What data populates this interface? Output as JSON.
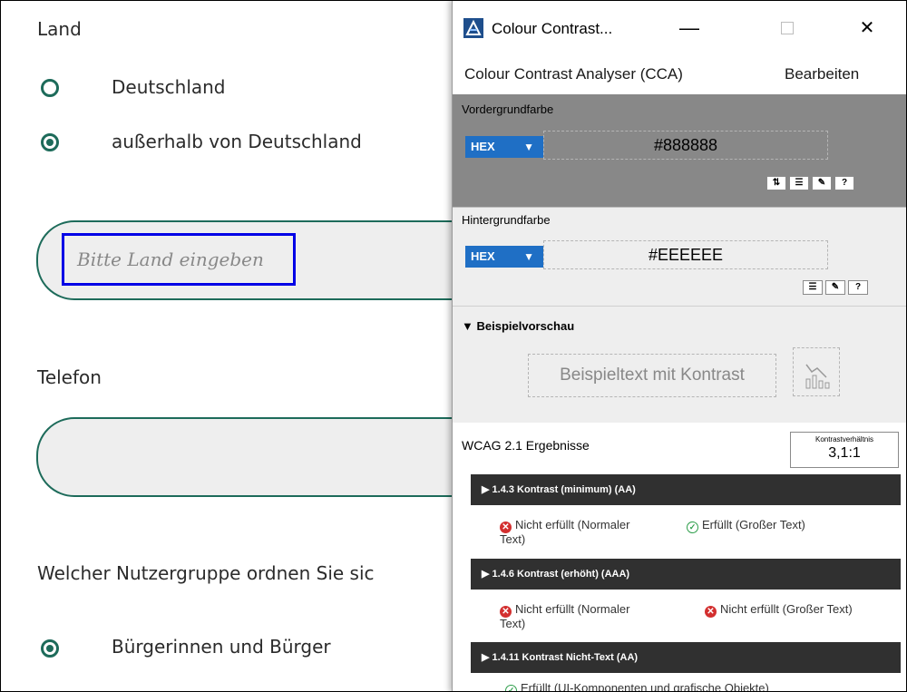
{
  "form": {
    "land_label": "Land",
    "options": [
      "Deutschland",
      "außerhalb von Deutschland"
    ],
    "country_placeholder": "Bitte Land eingeben",
    "telefon_label": "Telefon",
    "group_question": "Welcher Nutzergruppe ordnen Sie sic",
    "group_option": "Bürgerinnen und Bürger"
  },
  "cca": {
    "title": "Colour Contrast...",
    "minimize": "—",
    "close": "✕",
    "menu": {
      "app": "Colour Contrast Analyser (CCA)",
      "edit": "Bearbeiten"
    },
    "foreground": {
      "label": "Vordergrundfarbe",
      "format": "HEX",
      "value": "#888888",
      "color": "#888888"
    },
    "background": {
      "label": "Hintergrundfarbe",
      "format": "HEX",
      "value": "#EEEEEE",
      "color": "#EEEEEE"
    },
    "preview": {
      "label": "▼ Beispielvorschau",
      "sample": "Beispieltext mit Kontrast"
    },
    "results": {
      "title": "WCAG 2.1 Ergebnisse",
      "ratio_label": "Kontrastverhältnis",
      "ratio_value": "3,1:1",
      "criteria": [
        {
          "name": "▶  1.4.3 Kontrast (minimum) (AA)",
          "normal": "Nicht erfüllt (Normaler Text)",
          "large": "Erfüllt (Großer Text)"
        },
        {
          "name": "▶  1.4.6 Kontrast (erhöht) (AAA)",
          "normal": "Nicht erfüllt (Normaler Text)",
          "large": "Nicht erfüllt (Großer Text)"
        },
        {
          "name": "▶  1.4.11 Kontrast Nicht-Text (AA)",
          "result": "Erfüllt (UI-Komponenten und grafische Objekte)"
        }
      ]
    }
  },
  "colors": {
    "accent": "#1d6b5a",
    "highlight": "#0000e6",
    "header": "#303030",
    "fail": "#d32f2f",
    "pass": "#2e9e4b"
  }
}
